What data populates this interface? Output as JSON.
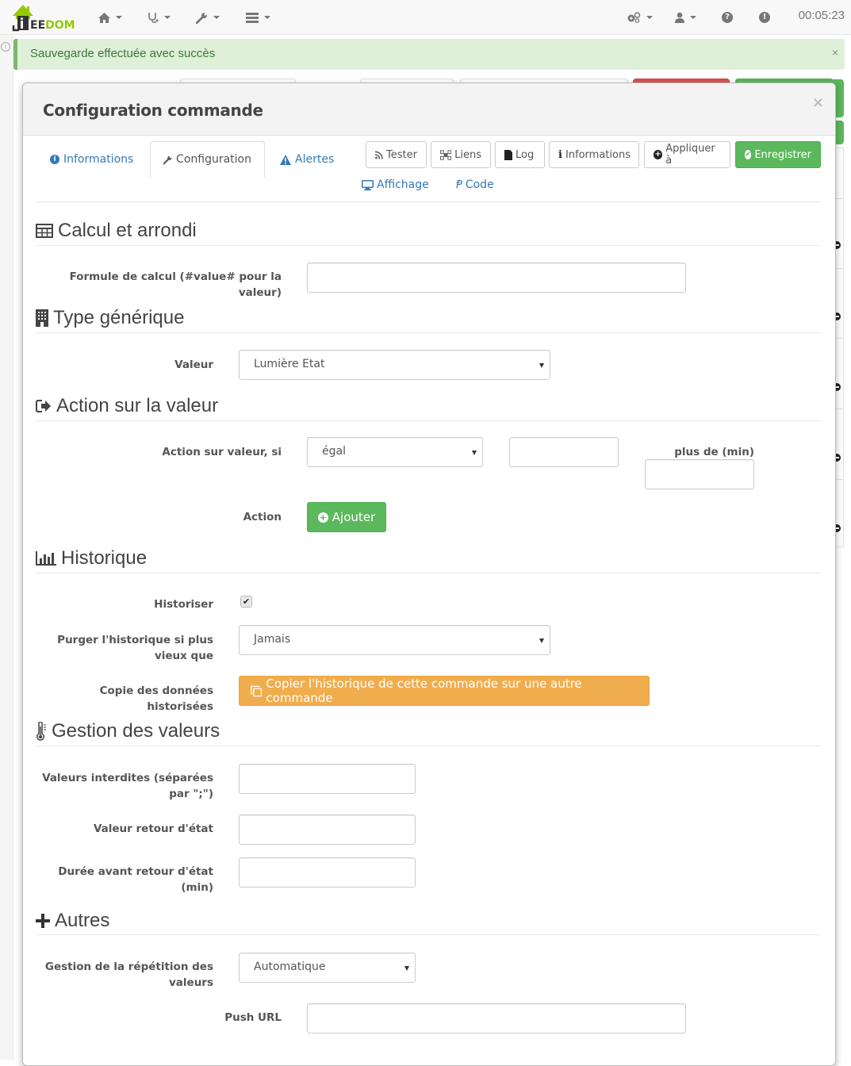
{
  "navbar": {
    "logo": {
      "prefix": "EE",
      "suffix": "DOM"
    },
    "menus": [
      {
        "icon": "home-icon"
      },
      {
        "icon": "stethoscope-icon"
      },
      {
        "icon": "wrench-icon"
      },
      {
        "icon": "server-icon"
      }
    ],
    "right_menus": [
      {
        "icon": "cogs-icon"
      },
      {
        "icon": "user-icon"
      },
      {
        "icon": "question-circle-icon"
      },
      {
        "icon": "exclamation-circle-icon"
      }
    ],
    "clock": "00:05:23"
  },
  "alert": {
    "message": "Sauvegarde effectuée avec succès",
    "close": "×",
    "color": "#dff0d8"
  },
  "modal": {
    "title": "Configuration commande",
    "close": "×",
    "tabs": [
      {
        "label": "Informations",
        "icon": "info-circle-icon",
        "active": false
      },
      {
        "label": "Configuration",
        "icon": "wrench-icon",
        "active": true
      },
      {
        "label": "Alertes",
        "icon": "warning-icon",
        "active": false
      },
      {
        "label": "Affichage",
        "icon": "desktop-icon",
        "active": false
      },
      {
        "label": "Code",
        "icon": "code-icon",
        "active": false
      }
    ],
    "toolbar": {
      "tester": "Tester",
      "liens": "Liens",
      "log": "Log",
      "informations": "Informations",
      "appliquer": "Appliquer à",
      "enregistrer": "Enregistrer"
    },
    "sections": {
      "calcul": {
        "title": "Calcul et arrondi",
        "formule_label": "Formule de calcul (#value# pour la valeur)",
        "formule_value": ""
      },
      "type_generique": {
        "title": "Type générique",
        "valeur_label": "Valeur",
        "valeur_selected": "Lumière Etat"
      },
      "action": {
        "title": "Action sur la valeur",
        "action_si_label": "Action sur valeur, si",
        "operator_selected": "égal",
        "compare_value": "",
        "plus_de_label": "plus de (min)",
        "plus_de_value": "",
        "action_label": "Action",
        "ajouter": "Ajouter"
      },
      "historique": {
        "title": "Historique",
        "historiser_label": "Historiser",
        "historiser_checked": true,
        "purger_label": "Purger l'historique si plus vieux que",
        "purger_selected": "Jamais",
        "copie_label": "Copie des données historisées",
        "copie_button": "Copier l'historique de cette commande sur une autre commande"
      },
      "gestion": {
        "title": "Gestion des valeurs",
        "interdites_label": "Valeurs interdites (séparées par \";\")",
        "interdites_value": "",
        "retour_label": "Valeur retour d'état",
        "retour_value": "",
        "duree_label": "Durée avant retour d'état (min)",
        "duree_value": ""
      },
      "autres": {
        "title": "Autres",
        "repetition_label": "Gestion de la répétition des valeurs",
        "repetition_selected": "Automatique",
        "push_label": "Push URL",
        "push_value": ""
      }
    }
  },
  "colors": {
    "primary_link": "#337ab7",
    "success": "#5cb85c",
    "warning": "#f0ad4e",
    "danger": "#d9534f",
    "brand_green": "#94ca02"
  }
}
